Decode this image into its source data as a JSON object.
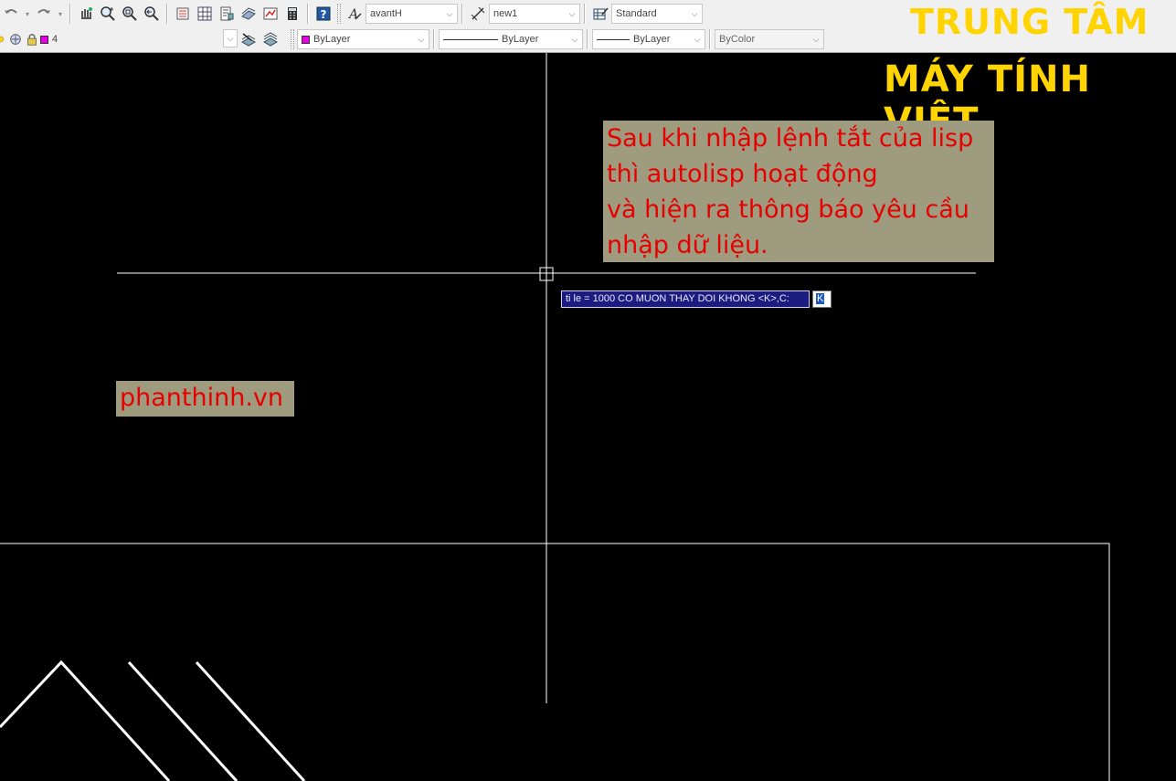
{
  "toolbar": {
    "row1": {
      "text_style": "avantH",
      "dim_style": "new1",
      "table_style": "Standard"
    },
    "row2": {
      "layer": "4",
      "color": "ByLayer",
      "linetype": "ByLayer",
      "lineweight": "ByLayer",
      "plot_style": "ByColor"
    }
  },
  "brand": {
    "line1": "TRUNG TÂM",
    "line2": "MÁY TÍNH VIỆT"
  },
  "note": {
    "lines": [
      "Sau khi nhập lệnh tắt của lisp",
      "thì autolisp hoạt động",
      "và hiện ra thông báo yêu cầu",
      "nhập dữ liệu."
    ]
  },
  "watermark": "phanthinh.vn",
  "command": {
    "prompt": "ti le = 1000 CO MUON THAY DOI KHONG <K>,C:",
    "input": "K"
  },
  "colors": {
    "brand": "#ffd400",
    "note_bg": "#9e9b7f",
    "note_text": "#e60000",
    "layer_swatch": "#e600e6"
  }
}
